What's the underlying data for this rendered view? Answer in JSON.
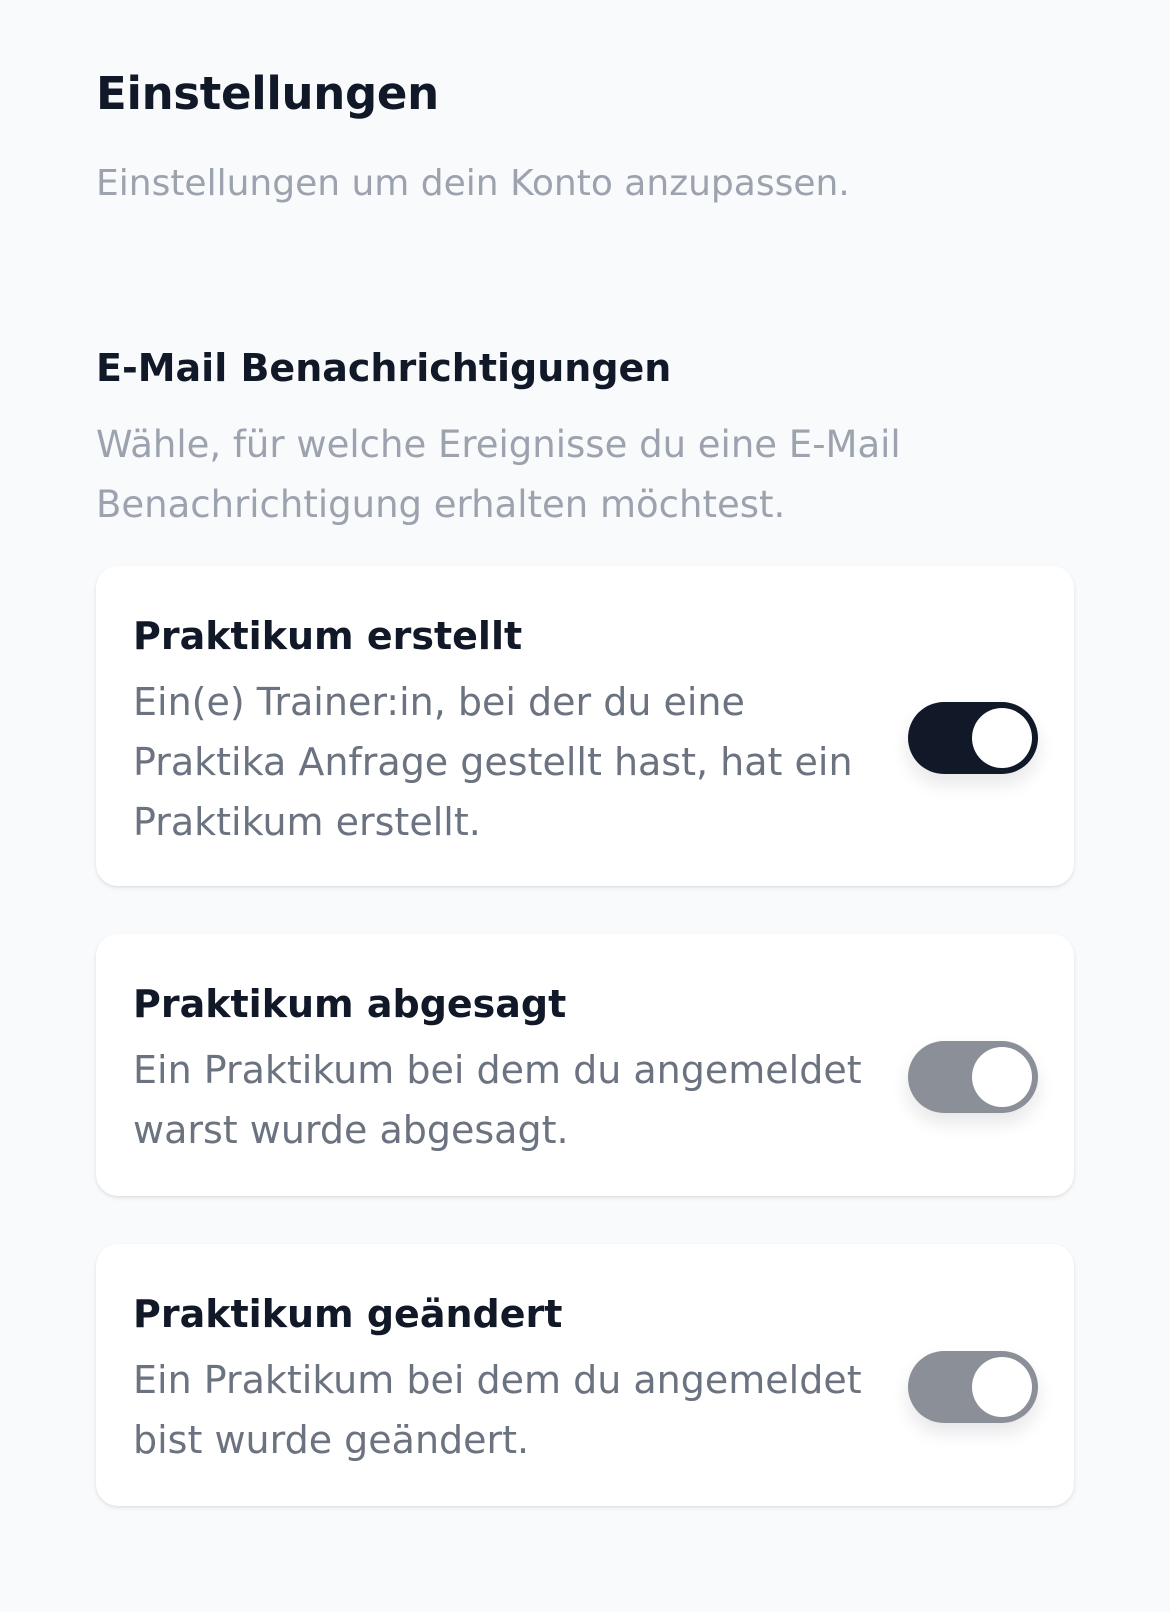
{
  "header": {
    "title": "Einstellungen",
    "subtitle": "Einstellungen um dein Konto anzupassen."
  },
  "email_section": {
    "title": "E-Mail Benachrichtigungen",
    "description": "Wähle, für welche Ereignisse du eine E-Mail Benachrichtigung erhalten möchtest.",
    "items": [
      {
        "title": "Praktikum erstellt",
        "description": "Ein(e) Trainer:in, bei der du eine Praktika Anfrage gestellt hast, hat ein Praktikum erstellt.",
        "enabled": true
      },
      {
        "title": "Praktikum abgesagt",
        "description": "Ein Praktikum bei dem du angemeldet warst wurde abgesagt.",
        "enabled": false
      },
      {
        "title": "Praktikum geändert",
        "description": "Ein Praktikum bei dem du angemeldet bist wurde geändert.",
        "enabled": false
      }
    ]
  },
  "colors": {
    "background": "#f9fafb",
    "toggle_on": "#111827",
    "toggle_off": "#8b8f98",
    "text_primary": "#111827",
    "text_muted": "#9ca3af",
    "text_secondary": "#6b7280"
  }
}
